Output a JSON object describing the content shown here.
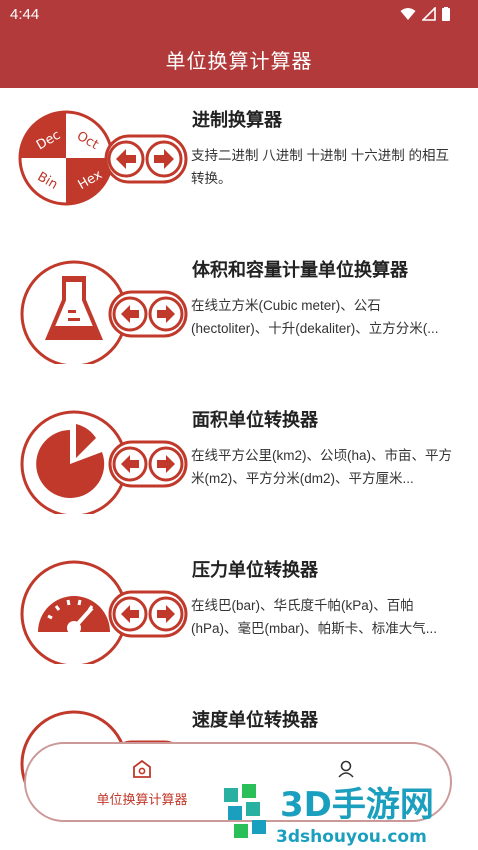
{
  "status_bar": {
    "time": "4:44"
  },
  "app_bar": {
    "title": "单位换算计算器"
  },
  "items": [
    {
      "title": "进制换算器",
      "description": "支持二进制 八进制 十进制 十六进制 的相互转换。",
      "icon_labels": [
        "Dec",
        "Oct",
        "Bin",
        "Hex"
      ]
    },
    {
      "title": "体积和容量计量单位换算器",
      "description": "在线立方米(Cubic meter)、公石(hectoliter)、十升(dekaliter)、立方分米(..."
    },
    {
      "title": "面积单位转换器",
      "description": "在线平方公里(km2)、公顷(ha)、市亩、平方米(m2)、平方分米(dm2)、平方厘米..."
    },
    {
      "title": "压力单位转换器",
      "description": "在线巴(bar)、华氏度千帕(kPa)、百帕(hPa)、毫巴(mbar)、帕斯卡、标准大气..."
    },
    {
      "title": "速度单位转换器",
      "description": ""
    }
  ],
  "bottom_nav": {
    "home_label": "单位换算计算器",
    "user_label": ""
  },
  "watermark": {
    "brand": "3D手游网",
    "url": "3dshouyou.com"
  },
  "colors": {
    "accent": "#b33a3a",
    "icon_red": "#c0392b"
  }
}
